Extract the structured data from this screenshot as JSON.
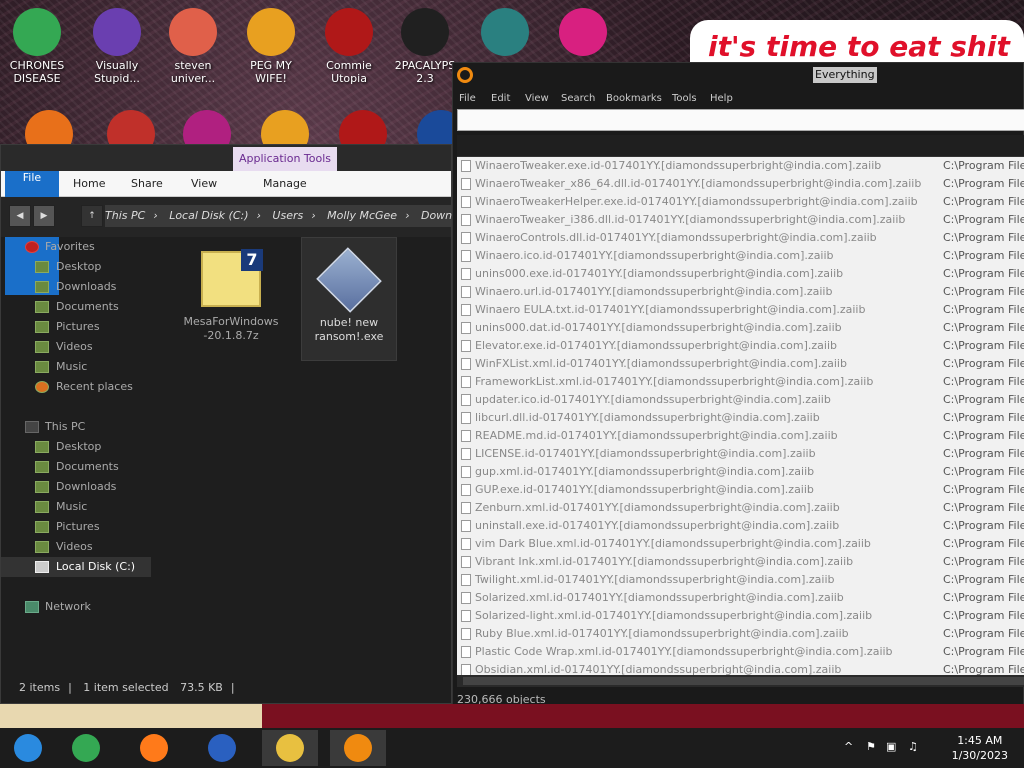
{
  "desktop": {
    "icons": [
      {
        "label": "CHRONES DISEASE",
        "icon": "chrome-icon",
        "color": "#34a853"
      },
      {
        "label": "Visually Stupid...",
        "icon": "visual-studio-icon",
        "color": "#6a3fb0"
      },
      {
        "label": "steven univer...",
        "icon": "cartoon-icon",
        "color": "#e0604a"
      },
      {
        "label": "PEG MY WIFE!",
        "icon": "pegasus-icon",
        "color": "#e8a020"
      },
      {
        "label": "Commie Utopia",
        "icon": "commie-icon",
        "color": "#b01818"
      },
      {
        "label": "2PACALYPS 2.3",
        "icon": "cmd-icon",
        "color": "#202020"
      },
      {
        "label": "",
        "icon": "santa-icon",
        "color": "#2a8080"
      },
      {
        "label": "",
        "icon": "monitor-icon",
        "color": "#d82080"
      }
    ],
    "banner": "it's time to eat shit"
  },
  "explorer": {
    "app_tools": "Application Tools",
    "tabs": {
      "file": "File",
      "home": "Home",
      "share": "Share",
      "view": "View",
      "manage": "Manage"
    },
    "breadcrumb": [
      "This PC",
      "Local Disk (C:)",
      "Users",
      "Molly McGee",
      "Down"
    ],
    "favorites_label": "Favorites",
    "favorites": [
      "Desktop",
      "Downloads",
      "Documents",
      "Pictures",
      "Videos",
      "Music",
      "Recent places"
    ],
    "thispc_label": "This PC",
    "thispc": [
      "Desktop",
      "Documents",
      "Downloads",
      "Music",
      "Pictures",
      "Videos"
    ],
    "localdisk": "Local Disk (C:)",
    "network": "Network",
    "files": [
      {
        "name": "MesaForWindows-20.1.8.7z",
        "icon": "7zip-archive-icon"
      },
      {
        "name": "nube! new ransom!.exe",
        "icon": "executable-icon"
      }
    ],
    "status": {
      "items": "2 items",
      "selected": "1 item selected",
      "size": "73.5 KB"
    }
  },
  "everything": {
    "title": "Everything",
    "menu": [
      "File",
      "Edit",
      "View",
      "Search",
      "Bookmarks",
      "Tools",
      "Help"
    ],
    "search_value": "",
    "path_prefix": "C:\\Program File",
    "rows": [
      "WinaeroTweaker.exe.id-017401YY.[diamondssuperbright@india.com].zaiib",
      "WinaeroTweaker_x86_64.dll.id-017401YY.[diamondssuperbright@india.com].zaiib",
      "WinaeroTweakerHelper.exe.id-017401YY.[diamondssuperbright@india.com].zaiib",
      "WinaeroTweaker_i386.dll.id-017401YY.[diamondssuperbright@india.com].zaiib",
      "WinaeroControls.dll.id-017401YY.[diamondssuperbright@india.com].zaiib",
      "Winaero.ico.id-017401YY.[diamondssuperbright@india.com].zaiib",
      "unins000.exe.id-017401YY.[diamondssuperbright@india.com].zaiib",
      "Winaero.url.id-017401YY.[diamondssuperbright@india.com].zaiib",
      "Winaero EULA.txt.id-017401YY.[diamondssuperbright@india.com].zaiib",
      "unins000.dat.id-017401YY.[diamondssuperbright@india.com].zaiib",
      "Elevator.exe.id-017401YY.[diamondssuperbright@india.com].zaiib",
      "WinFXList.xml.id-017401YY.[diamondssuperbright@india.com].zaiib",
      "FrameworkList.xml.id-017401YY.[diamondssuperbright@india.com].zaiib",
      "updater.ico.id-017401YY.[diamondssuperbright@india.com].zaiib",
      "libcurl.dll.id-017401YY.[diamondssuperbright@india.com].zaiib",
      "README.md.id-017401YY.[diamondssuperbright@india.com].zaiib",
      "LICENSE.id-017401YY.[diamondssuperbright@india.com].zaiib",
      "gup.xml.id-017401YY.[diamondssuperbright@india.com].zaiib",
      "GUP.exe.id-017401YY.[diamondssuperbright@india.com].zaiib",
      "Zenburn.xml.id-017401YY.[diamondssuperbright@india.com].zaiib",
      "uninstall.exe.id-017401YY.[diamondssuperbright@india.com].zaiib",
      "vim Dark Blue.xml.id-017401YY.[diamondssuperbright@india.com].zaiib",
      "Vibrant Ink.xml.id-017401YY.[diamondssuperbright@india.com].zaiib",
      "Twilight.xml.id-017401YY.[diamondssuperbright@india.com].zaiib",
      "Solarized.xml.id-017401YY.[diamondssuperbright@india.com].zaiib",
      "Solarized-light.xml.id-017401YY.[diamondssuperbright@india.com].zaiib",
      "Ruby Blue.xml.id-017401YY.[diamondssuperbright@india.com].zaiib",
      "Plastic Code Wrap.xml.id-017401YY.[diamondssuperbright@india.com].zaiib",
      "Obsidian.xml.id-017401YY.[diamondssuperbright@india.com].zaiib"
    ],
    "status": "230,666 objects"
  },
  "taskbar": {
    "apps": [
      {
        "name": "start-button",
        "color": "#2a8adf"
      },
      {
        "name": "chrome-taskbar",
        "color": "#34a853"
      },
      {
        "name": "firefox-taskbar",
        "color": "#ff7a1a"
      },
      {
        "name": "obama-taskbar",
        "color": "#2a60c0"
      },
      {
        "name": "explorer-taskbar",
        "color": "#e8c040"
      },
      {
        "name": "everything-taskbar",
        "color": "#f08a10"
      }
    ],
    "time": "1:45 AM",
    "date": "1/30/2023"
  }
}
